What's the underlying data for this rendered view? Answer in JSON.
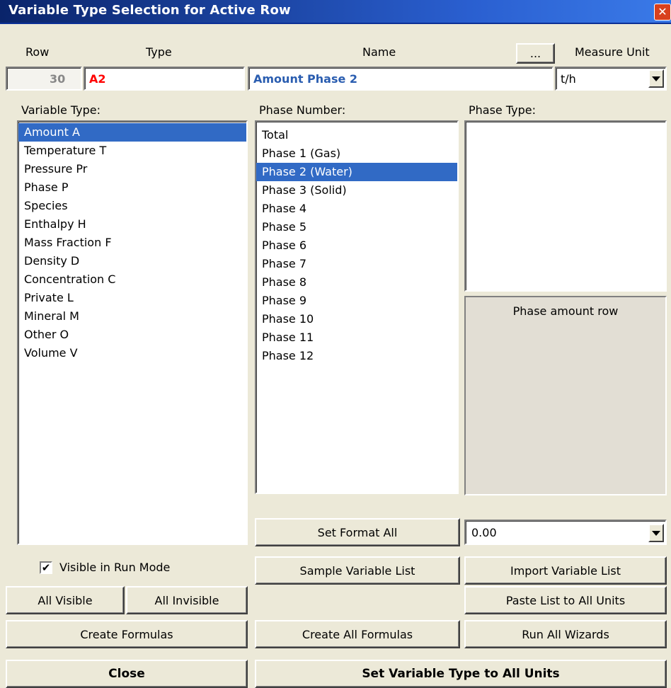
{
  "window": {
    "title": "Variable Type Selection for Active Row",
    "close_glyph": "✕"
  },
  "header": {
    "row_label": "Row",
    "type_label": "Type",
    "name_label": "Name",
    "ellipsis_label": "...",
    "unit_label": "Measure Unit",
    "row_value": "30",
    "type_value": "A2",
    "name_value": "Amount Phase 2",
    "unit_value": "t/h"
  },
  "variable_type": {
    "label": "Variable Type:",
    "items": [
      "Amount A",
      "Temperature T",
      "Pressure Pr",
      "Phase P",
      "Species",
      "Enthalpy H",
      "Mass Fraction F",
      "Density D",
      "Concentration C",
      "Private L",
      "Mineral M",
      "Other O",
      "Volume V"
    ],
    "selected": "Amount A"
  },
  "phase_number": {
    "label": "Phase Number:",
    "items": [
      "Total",
      "Phase 1 (Gas)",
      "Phase 2 (Water)",
      "Phase 3 (Solid)",
      "Phase 4",
      "Phase 5",
      "Phase 6",
      "Phase 7",
      "Phase 8",
      "Phase 9",
      "Phase 10",
      "Phase 11",
      "Phase 12"
    ],
    "selected": "Phase 2 (Water)"
  },
  "phase_type": {
    "label": "Phase Type:",
    "description": "Phase amount row"
  },
  "format": {
    "button": "Set Format All",
    "value": "0.00"
  },
  "buttons": {
    "visible_run_mode": "Visible in Run Mode",
    "all_visible": "All Visible",
    "all_invisible": "All Invisible",
    "create_formulas": "Create Formulas",
    "sample_list": "Sample Variable List",
    "import_list": "Import Variable List",
    "paste_list": "Paste List to All Units",
    "create_all_formulas": "Create All Formulas",
    "run_wizards": "Run All Wizards",
    "close": "Close",
    "set_all_units": "Set Variable Type to All Units"
  },
  "colors": {
    "title_bar": "#0a246a",
    "selection": "#316ac5",
    "type_value_text": "#ff0000",
    "name_value_text": "#2a5db0",
    "row_value_text": "#888888"
  },
  "icons": {
    "checkbox_checked": "✔",
    "dropdown": "chevron-down-icon"
  }
}
